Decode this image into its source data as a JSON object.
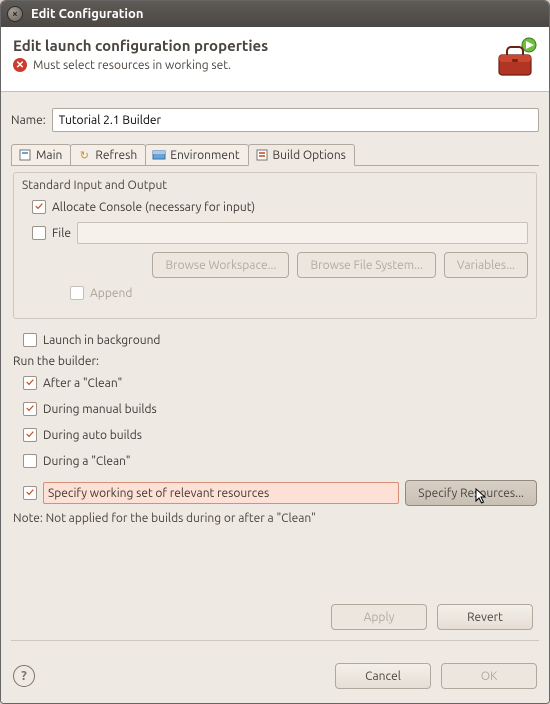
{
  "window": {
    "title": "Edit Configuration"
  },
  "banner": {
    "heading": "Edit launch configuration properties",
    "error": "Must select resources in working set."
  },
  "name": {
    "label": "Name:",
    "value": "Tutorial 2.1 Builder"
  },
  "tabs": [
    {
      "label": "Main"
    },
    {
      "label": "Refresh"
    },
    {
      "label": "Environment"
    },
    {
      "label": "Build Options"
    }
  ],
  "group": {
    "legend": "Standard Input and Output",
    "allocate": "Allocate Console (necessary for input)",
    "file": "File",
    "browseWs": "Browse Workspace...",
    "browseFs": "Browse File System...",
    "variables": "Variables...",
    "append": "Append"
  },
  "launchBg": "Launch in background",
  "runHeader": "Run the builder:",
  "run": {
    "afterClean": "After a \"Clean\"",
    "manual": "During manual builds",
    "auto": "During auto builds",
    "duringClean": "During a \"Clean\""
  },
  "workingSet": {
    "label": "Specify working set of relevant resources",
    "button": "Specify Resources..."
  },
  "note": "Note: Not applied for the builds during or after a \"Clean\"",
  "buttons": {
    "apply": "Apply",
    "revert": "Revert",
    "cancel": "Cancel",
    "ok": "OK"
  }
}
